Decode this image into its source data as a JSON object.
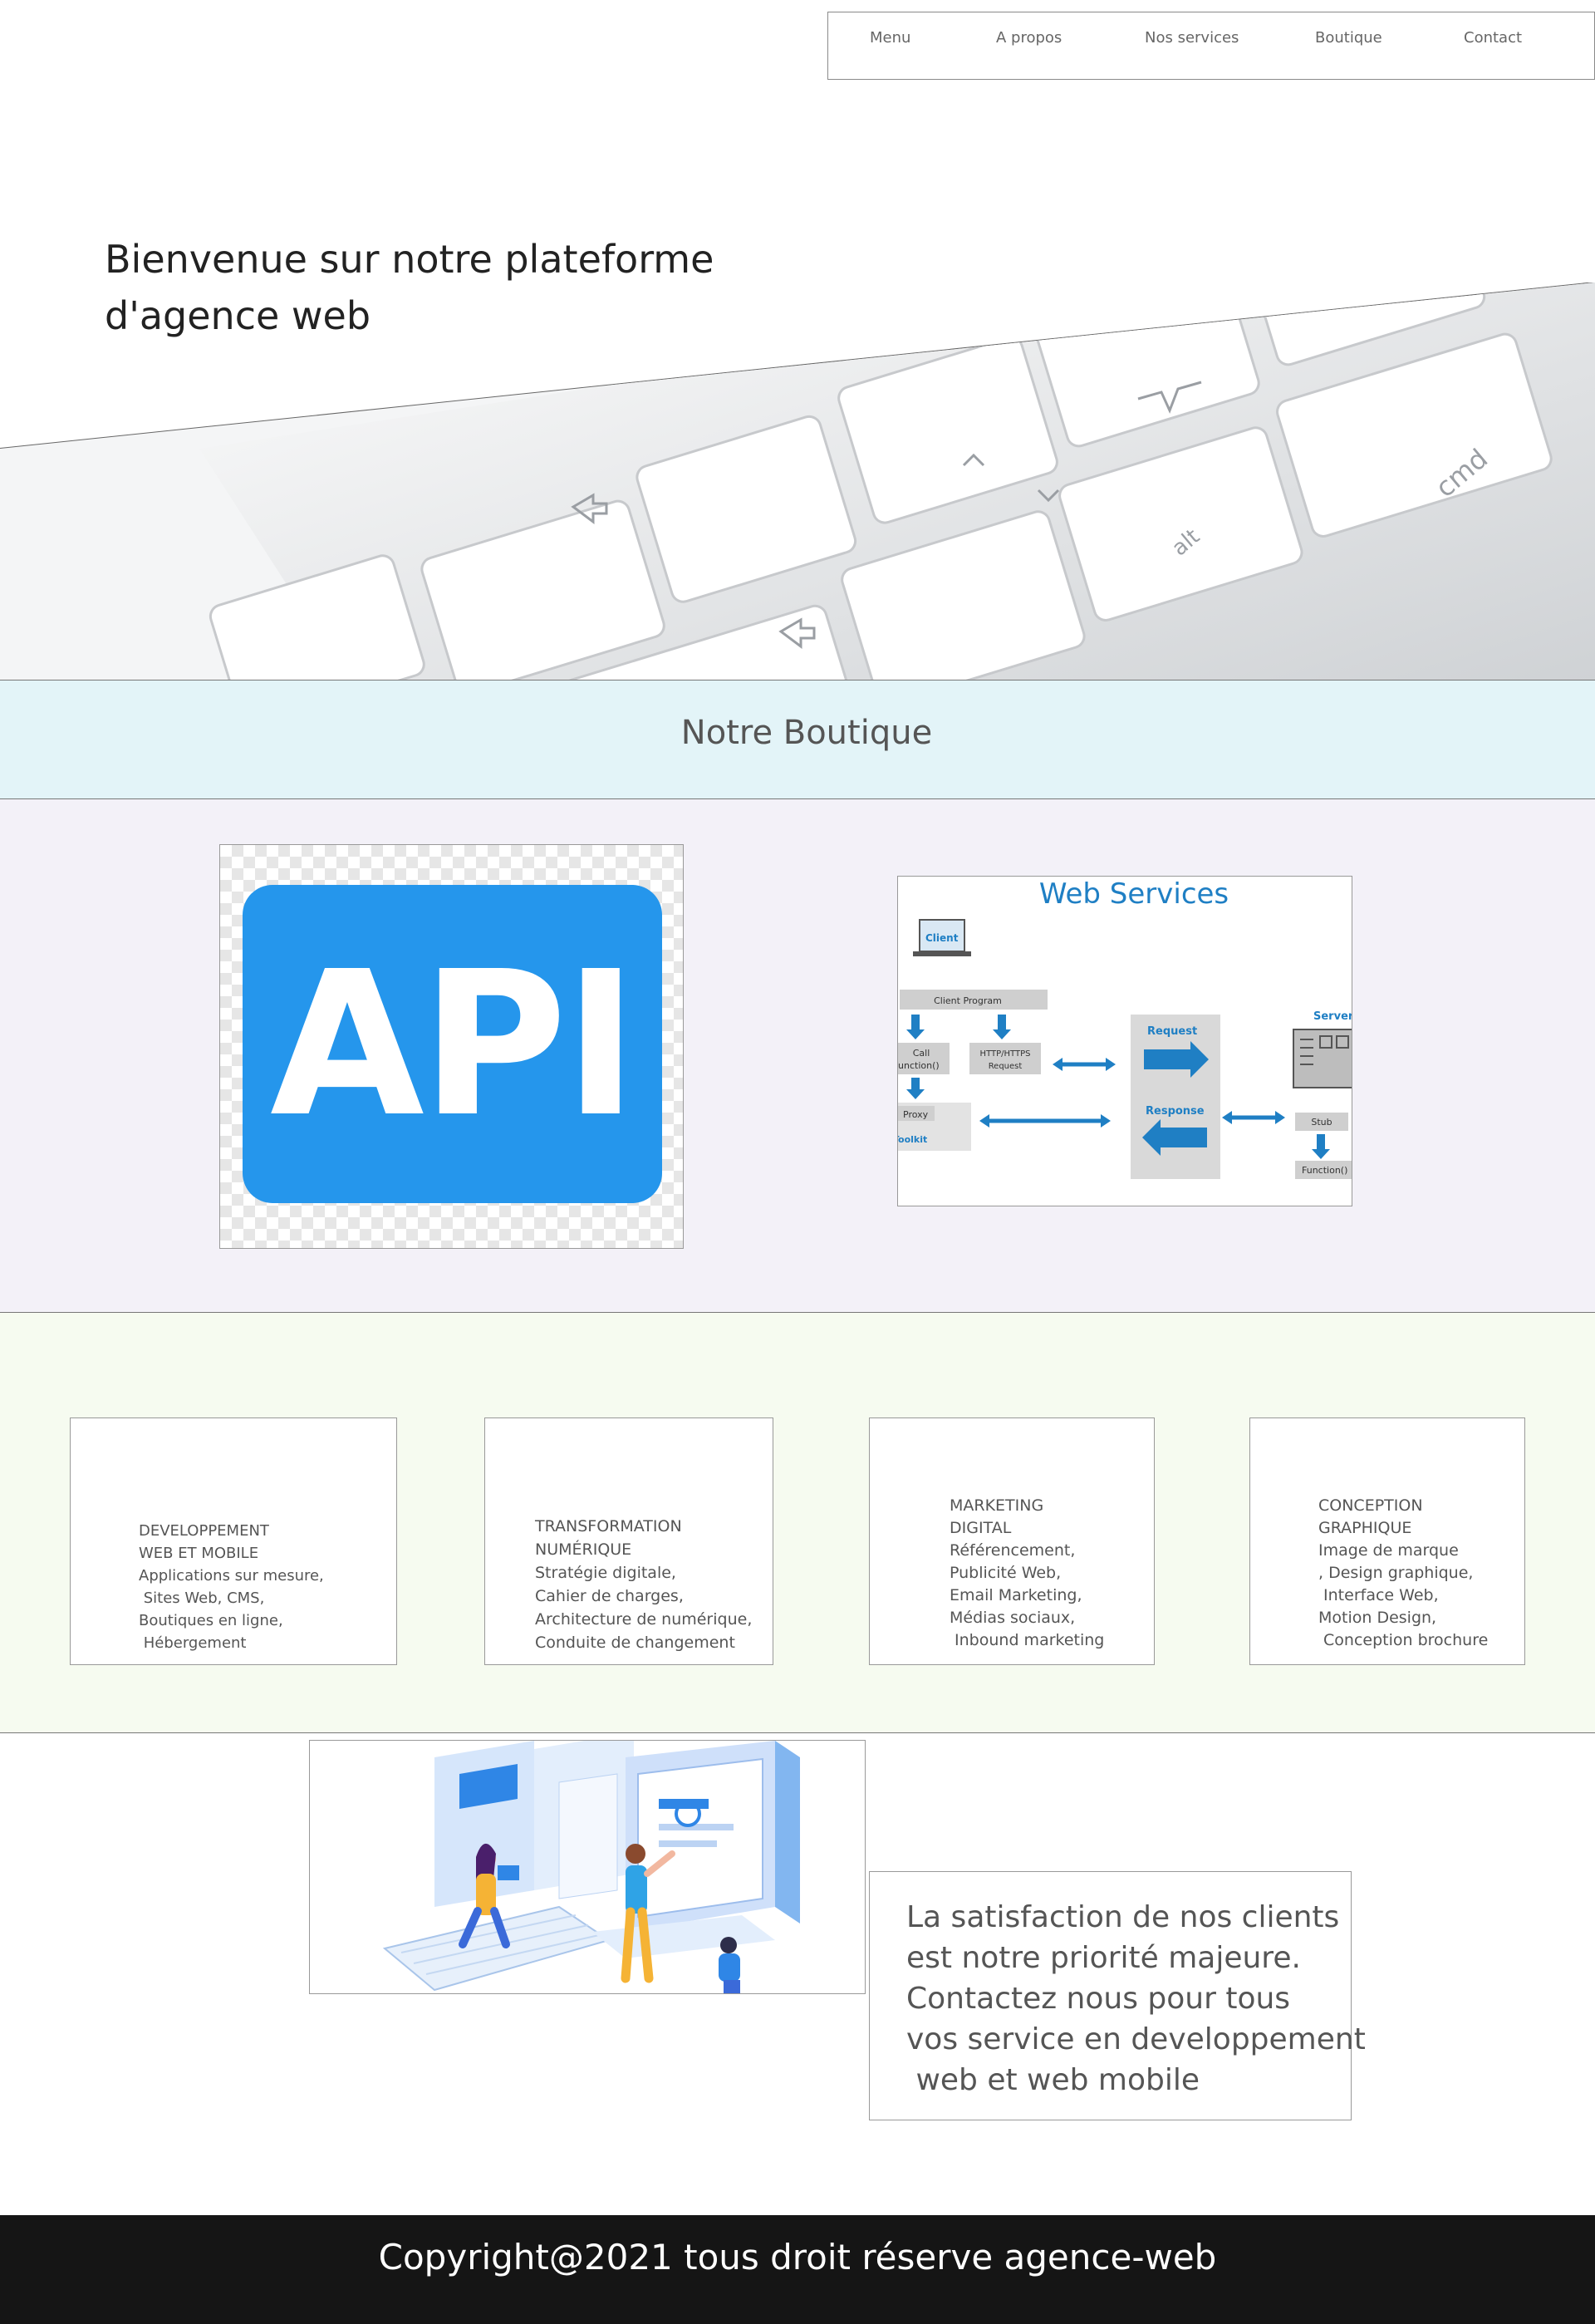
{
  "nav": {
    "items": [
      "Menu",
      "A propos",
      "Nos services",
      "Boutique",
      "Contact"
    ]
  },
  "hero": {
    "title_line1": "Bienvenue sur notre plateforme",
    "title_line2": "d'agence web"
  },
  "boutique": {
    "title": "Notre Boutique",
    "api_image_text": "API",
    "web_services": {
      "title": "Web Services",
      "client": "Client",
      "client_program": "Client Program",
      "call_line1": "Call",
      "call_line2": "Function()",
      "http_line1": "HTTP/HTTPS",
      "http_line2": "Request",
      "proxy": "Proxy",
      "toolkit": "Toolkit",
      "request": "Request",
      "response": "Response",
      "server": "Server",
      "stub": "Stub",
      "function": "Function()"
    }
  },
  "services": [
    {
      "title_line1": "DEVELOPPEMENT",
      "title_line2": "WEB ET MOBILE",
      "lines": [
        "Applications sur mesure,",
        " Sites Web, CMS,",
        "Boutiques en ligne,",
        " Hébergement"
      ]
    },
    {
      "title_line1": "TRANSFORMATION",
      "title_line2": "NUMÉRIQUE",
      "lines": [
        "Stratégie digitale,",
        "Cahier de charges,",
        "Architecture de numérique,",
        "Conduite de changement"
      ]
    },
    {
      "title_line1": "MARKETING",
      "title_line2": "DIGITAL",
      "lines": [
        "Référencement,",
        "Publicité Web,",
        "Email Marketing,",
        "Médias sociaux,",
        " Inbound marketing"
      ]
    },
    {
      "title_line1": "CONCEPTION",
      "title_line2": "GRAPHIQUE",
      "lines": [
        "Image de marque",
        ", Design graphique,",
        " Interface Web,",
        "Motion Design,",
        " Conception brochure"
      ]
    }
  ],
  "contact": {
    "lines": [
      "La satisfaction de nos clients",
      "est notre priorité majeure.",
      "Contactez nous pour tous",
      "vos service en developpement",
      " web et web mobile"
    ]
  },
  "footer": {
    "text": "Copyright@2021 tous droit  réserve agence-web"
  },
  "colors": {
    "boutique_bg": "#e3f4f8",
    "products_bg": "#f3f1f8",
    "services_bg": "#f6fbf0",
    "footer_bg": "#151515",
    "api_blue": "#2596ec",
    "ws_blue": "#1f7fc4"
  }
}
